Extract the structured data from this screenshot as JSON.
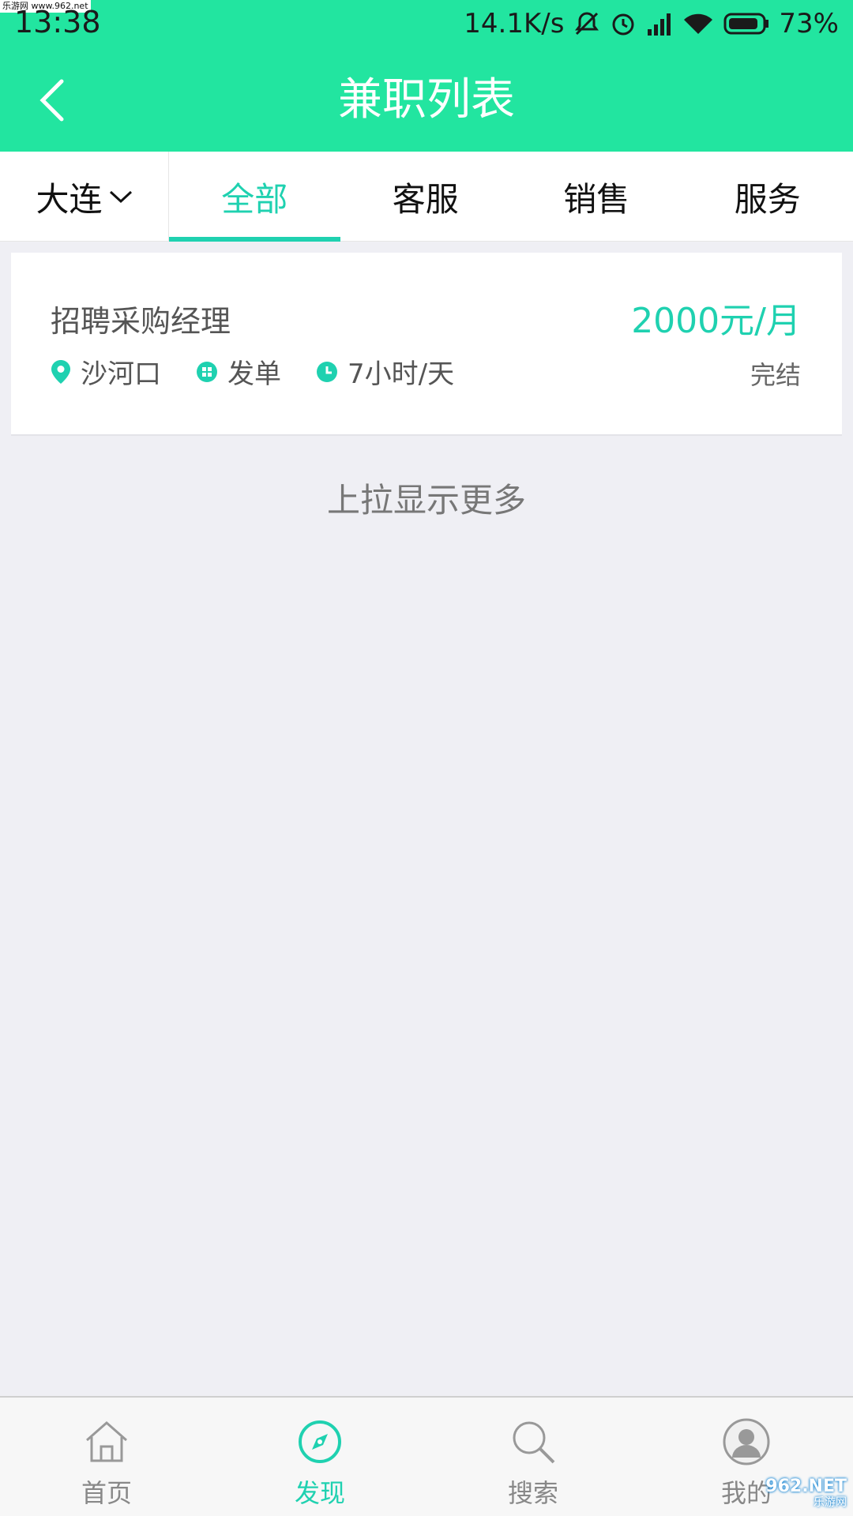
{
  "status_bar": {
    "time": "13:38",
    "network_speed": "14.1K/s",
    "battery": "73%",
    "watermark": "乐游网 www.962.net"
  },
  "header": {
    "title": "兼职列表"
  },
  "filter_bar": {
    "city": "大连",
    "tabs": [
      {
        "label": "全部",
        "active": true
      },
      {
        "label": "客服",
        "active": false
      },
      {
        "label": "销售",
        "active": false
      },
      {
        "label": "服务",
        "active": false
      }
    ]
  },
  "jobs": [
    {
      "title": "招聘采购经理",
      "salary": "2000元/月",
      "location": "沙河口",
      "type": "发单",
      "hours": "7小时/天",
      "status": "完结"
    }
  ],
  "load_more": "上拉显示更多",
  "bottom_nav": {
    "items": [
      {
        "label": "首页",
        "icon": "home-icon",
        "active": false
      },
      {
        "label": "发现",
        "icon": "compass-icon",
        "active": true
      },
      {
        "label": "搜索",
        "icon": "search-icon",
        "active": false
      },
      {
        "label": "我的",
        "icon": "user-icon",
        "active": false
      }
    ]
  },
  "watermark_br": {
    "main": "962.NET",
    "sub": "乐游网"
  },
  "colors": {
    "header_green": "#22e5a0",
    "accent_teal": "#1fd1b0",
    "background": "#efeff4"
  }
}
